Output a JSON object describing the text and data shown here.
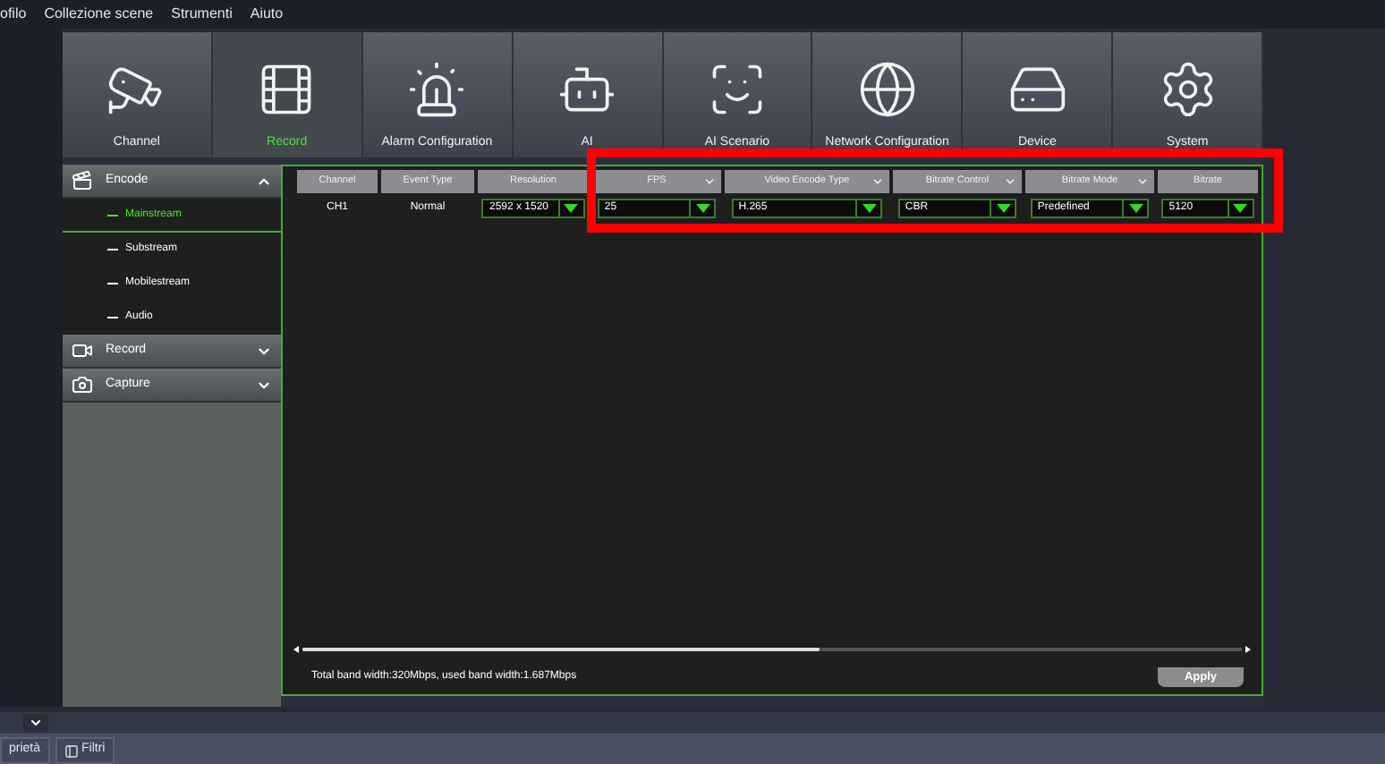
{
  "menu": [
    "ofilo",
    "Collezione scene",
    "Strumenti",
    "Aiuto"
  ],
  "tabs": [
    {
      "label": "Channel",
      "selected": false
    },
    {
      "label": "Record",
      "selected": true
    },
    {
      "label": "Alarm Configuration",
      "selected": false
    },
    {
      "label": "AI",
      "selected": false
    },
    {
      "label": "AI Scenario",
      "selected": false
    },
    {
      "label": "Network Configuration",
      "selected": false
    },
    {
      "label": "Device",
      "selected": false
    },
    {
      "label": "System",
      "selected": false
    }
  ],
  "sidebar": [
    {
      "label": "Encode",
      "expanded": true,
      "children": [
        {
          "label": "Mainstream",
          "selected": true
        },
        {
          "label": "Substream",
          "selected": false
        },
        {
          "label": "Mobilestream",
          "selected": false
        },
        {
          "label": "Audio",
          "selected": false
        }
      ]
    },
    {
      "label": "Record",
      "expanded": false
    },
    {
      "label": "Capture",
      "expanded": false
    }
  ],
  "table": {
    "columns": [
      {
        "label": "Channel",
        "dropdown": false
      },
      {
        "label": "Event Type",
        "dropdown": false
      },
      {
        "label": "Resolution",
        "dropdown": false
      },
      {
        "label": "FPS",
        "dropdown": true
      },
      {
        "label": "Video Encode Type",
        "dropdown": true
      },
      {
        "label": "Bitrate Control",
        "dropdown": true
      },
      {
        "label": "Bitrate Mode",
        "dropdown": true
      },
      {
        "label": "Bitrate",
        "dropdown": false
      }
    ],
    "rows": [
      [
        {
          "kind": "text",
          "value": "CH1"
        },
        {
          "kind": "text",
          "value": "Normal"
        },
        {
          "kind": "select",
          "value": "2592 x 1520"
        },
        {
          "kind": "select",
          "value": "25"
        },
        {
          "kind": "select",
          "value": "H.265"
        },
        {
          "kind": "select",
          "value": "CBR"
        },
        {
          "kind": "select",
          "value": "Predefined"
        },
        {
          "kind": "select",
          "value": "5120"
        }
      ]
    ]
  },
  "scrollbar": {
    "level": 0.55
  },
  "footer": {
    "text": "Total band width:320Mbps, used band width:1.687Mbps",
    "button": "Apply"
  },
  "bottom_tabs": [
    "prietà",
    "Filtri"
  ]
}
